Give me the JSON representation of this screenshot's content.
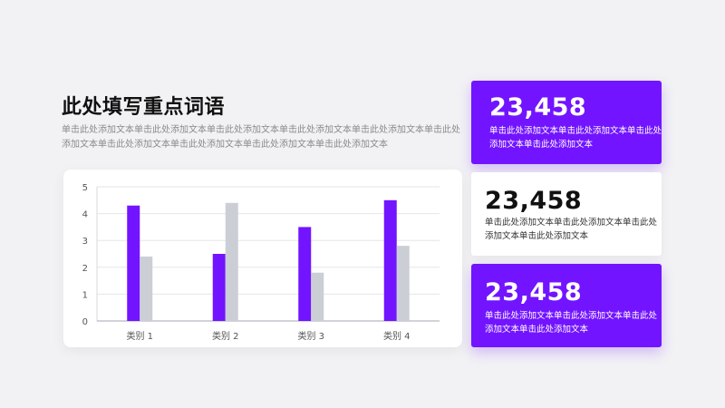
{
  "title": "此处填写重点词语",
  "description": "单击此处添加文本单击此处添加文本单击此处添加文本单击此处添加文本单击此处添加文本单击此处添加文本单击此处添加文本单击此处添加文本单击此处添加文本单击此处添加文本",
  "stats": [
    {
      "value": "23,458",
      "text": "单击此处添加文本单击此处添加文本单击此处添加文本单击此处添加文本",
      "style": "purple"
    },
    {
      "value": "23,458",
      "text": "单击此处添加文本单击此处添加文本单击此处添加文本单击此处添加文本",
      "style": "white"
    },
    {
      "value": "23,458",
      "text": "单击此处添加文本单击此处添加文本单击此处添加文本单击此处添加文本",
      "style": "purple"
    }
  ],
  "colors": {
    "accent": "#7214ff",
    "series2": "#ccced6",
    "background": "#f2f2f4"
  },
  "chart_data": {
    "type": "bar",
    "categories": [
      "类别 1",
      "类别 2",
      "类别 3",
      "类别 4"
    ],
    "series": [
      {
        "values": [
          4.3,
          2.5,
          3.5,
          4.5
        ]
      },
      {
        "values": [
          2.4,
          4.4,
          1.8,
          2.8
        ]
      }
    ],
    "ylim": [
      0,
      5
    ],
    "yticks": [
      0,
      1,
      2,
      3,
      4,
      5
    ],
    "grid": true,
    "legend": "none"
  }
}
